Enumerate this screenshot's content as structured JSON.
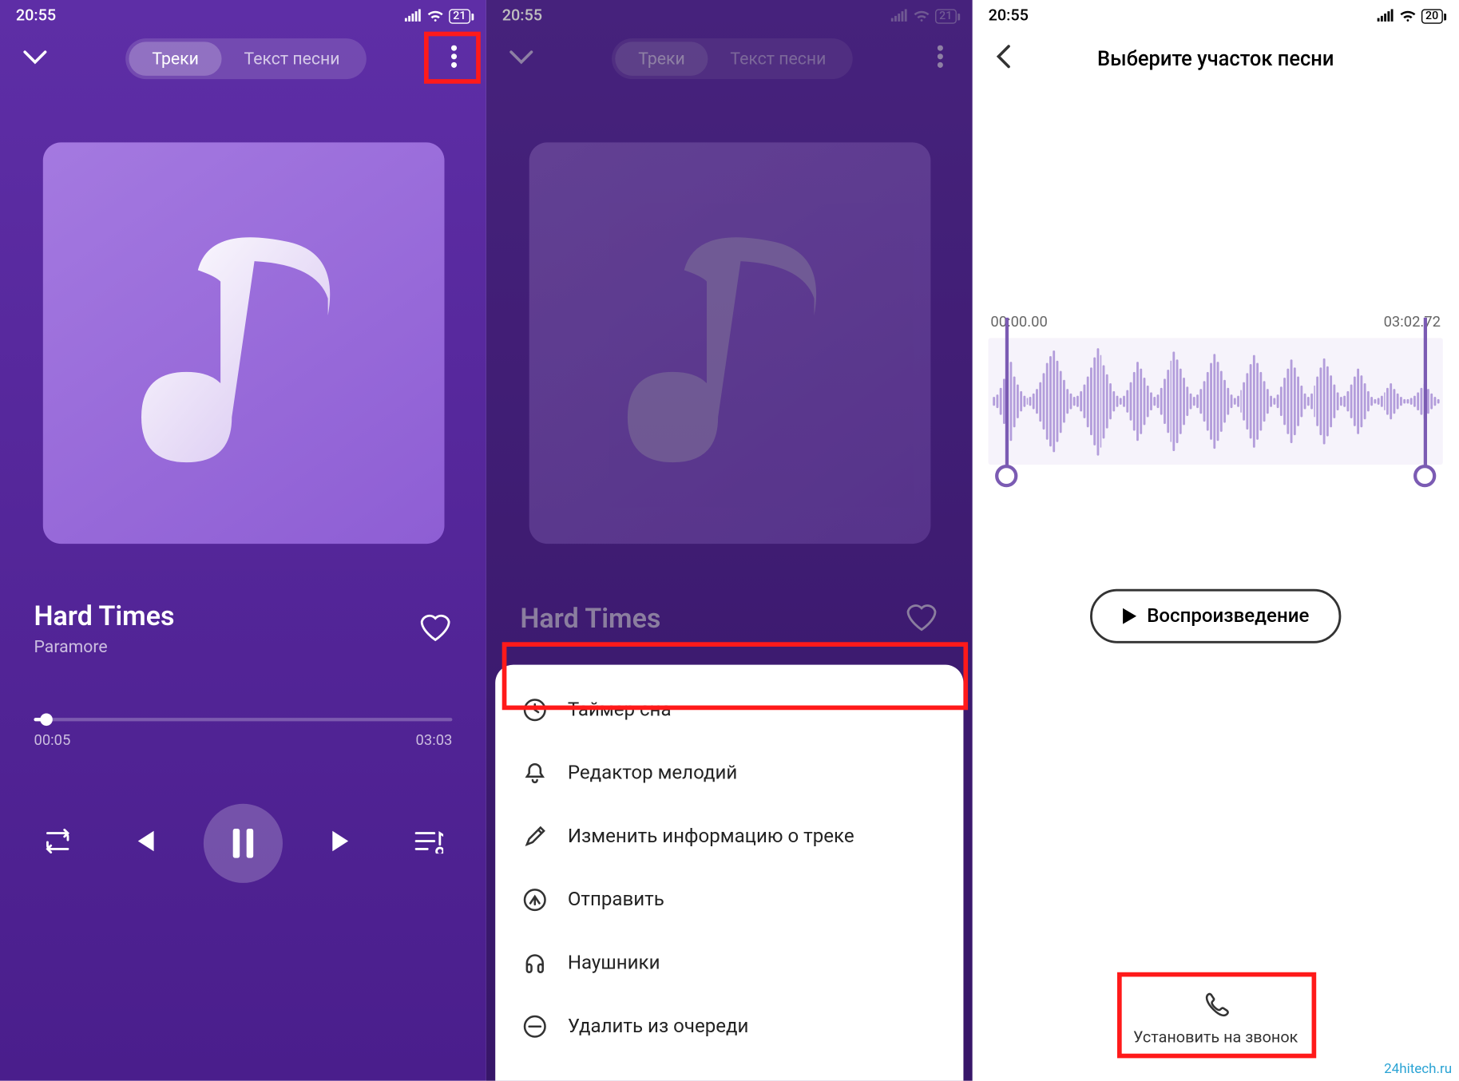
{
  "status": {
    "time": "20:55",
    "battery1": "21",
    "battery3": "20"
  },
  "tabs": {
    "tracks": "Треки",
    "lyrics": "Текст песни"
  },
  "song": {
    "title": "Hard Times",
    "artist": "Paramore"
  },
  "progress": {
    "elapsed": "00:05",
    "total": "03:03",
    "percent": 3
  },
  "menu": {
    "sleep": "Таймер сна",
    "ringtone_editor": "Редактор мелодий",
    "edit_info": "Изменить информацию о треке",
    "send": "Отправить",
    "headphones": "Наушники",
    "remove_queue": "Удалить из очереди"
  },
  "editor": {
    "title": "Выберите участок песни",
    "start": "00:00.00",
    "end": "03:02.72",
    "play": "Воспроизведение",
    "set_ringtone": "Установить на звонок"
  },
  "watermark": "24hitech.ru"
}
